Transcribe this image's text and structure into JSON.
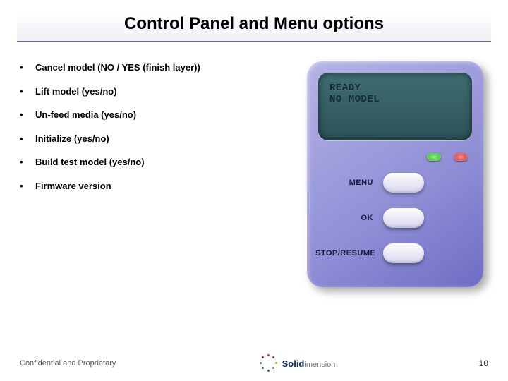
{
  "title": "Control Panel and Menu options",
  "bullets": [
    "Cancel model (NO / YES (finish layer))",
    "Lift model (yes/no)",
    "Un-feed media (yes/no)",
    "Initialize (yes/no)",
    "Build test model (yes/no)",
    "Firmware version"
  ],
  "device": {
    "screen_line1": "READY",
    "screen_line2": "NO MODEL",
    "buttons": [
      {
        "label": "MENU"
      },
      {
        "label": "OK"
      },
      {
        "label": "STOP/RESUME"
      }
    ],
    "leds": [
      "green",
      "red"
    ]
  },
  "footer": {
    "confidential": "Confidential and Proprietary",
    "logo_bold": "Solid",
    "logo_rest": "imension",
    "page": "10"
  }
}
